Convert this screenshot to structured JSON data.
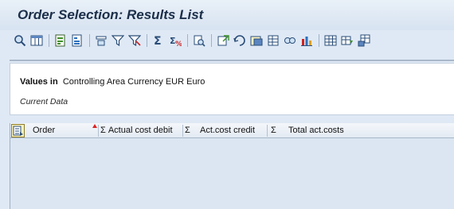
{
  "window": {
    "title": "Order Selection: Results List"
  },
  "toolbar": {
    "buttons": [
      {
        "icon": "details-icon",
        "group": 1
      },
      {
        "icon": "layout-icon",
        "group": 1
      },
      {
        "icon": "sort-ascending-icon",
        "group": 2
      },
      {
        "icon": "sort-descending-icon",
        "group": 2
      },
      {
        "icon": "find-icon",
        "group": 3
      },
      {
        "icon": "set-filter-icon",
        "group": 3
      },
      {
        "icon": "delete-filter-icon",
        "group": 3
      },
      {
        "icon": "total-icon",
        "group": 4
      },
      {
        "icon": "subtotal-icon",
        "group": 4
      },
      {
        "icon": "print-preview-icon",
        "group": 5
      },
      {
        "icon": "export-icon",
        "group": 6
      },
      {
        "icon": "send-icon",
        "group": 6
      },
      {
        "icon": "word-processing-icon",
        "group": 6
      },
      {
        "icon": "spreadsheet-icon",
        "group": 6
      },
      {
        "icon": "local-file-icon",
        "group": 6
      },
      {
        "icon": "graphic-icon",
        "group": 6
      },
      {
        "icon": "choose-layout-icon",
        "group": 7
      },
      {
        "icon": "change-layout-icon",
        "group": 7
      },
      {
        "icon": "save-layout-icon",
        "group": 7
      }
    ]
  },
  "info": {
    "values_label": "Values in",
    "values_text": "Controlling Area Currency EUR Euro",
    "current_data": "Current Data"
  },
  "grid": {
    "columns": [
      {
        "label": "Order",
        "sigma": ""
      },
      {
        "label": "Actual cost debit",
        "sigma": "Σ"
      },
      {
        "label": "Act.cost credit",
        "sigma": "Σ"
      },
      {
        "label": "Total act.costs",
        "sigma": "Σ"
      }
    ],
    "rows": []
  },
  "colors": {
    "background": "#dfe9f5",
    "title_text": "#1c2f4a",
    "sort_indicator": "#dd2222"
  }
}
